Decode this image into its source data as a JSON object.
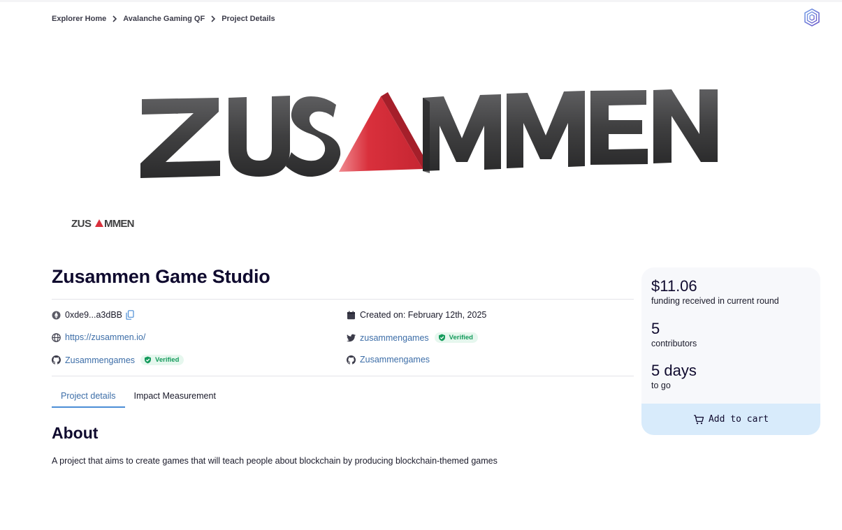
{
  "breadcrumb": {
    "items": [
      "Explorer Home",
      "Avalanche Gaming QF",
      "Project Details"
    ]
  },
  "banner": {
    "logo_text": "ZUSAMMEN",
    "accent_color": "#d9303c",
    "letter_color": "#3f3f40"
  },
  "avatar": {
    "logo_text": "ZUSAMMEN"
  },
  "project": {
    "title": "Zusammen Game Studio",
    "address": "0xde9...a3dBB",
    "created_on": "Created on: February 12th, 2025",
    "website": "https://zusammen.io/",
    "twitter": "zusammengames",
    "twitter_badge": "Verified",
    "github_user": "Zusammengames",
    "github_badge": "Verified",
    "github_org": "Zusammengames"
  },
  "tabs": [
    {
      "label": "Project details",
      "active": true
    },
    {
      "label": "Impact Measurement",
      "active": false
    }
  ],
  "about": {
    "heading": "About",
    "text": "A project that aims to create games that will teach people about blockchain by producing blockchain-themed games"
  },
  "stats": {
    "funding_value": "$11.06",
    "funding_label": "funding received in current round",
    "contributors_value": "5",
    "contributors_label": "contributors",
    "days_value": "5 days",
    "days_label": "to go",
    "cart_button": "Add to cart"
  },
  "colors": {
    "link": "#3d6ea8",
    "verified": "#159b5c",
    "verified_bg": "#e6f7ee",
    "card_bg": "#f7f8fb",
    "cart_bg": "#d8ebfb"
  },
  "icons": {
    "copy": "copy-icon",
    "address": "ethereum-icon",
    "calendar": "calendar-icon",
    "globe": "globe-icon",
    "twitter": "twitter-icon",
    "github": "github-icon",
    "verified": "shield-check-icon",
    "cart": "cart-icon",
    "chevron": "chevron-right-icon",
    "brand": "gitcoin-logo-icon"
  }
}
